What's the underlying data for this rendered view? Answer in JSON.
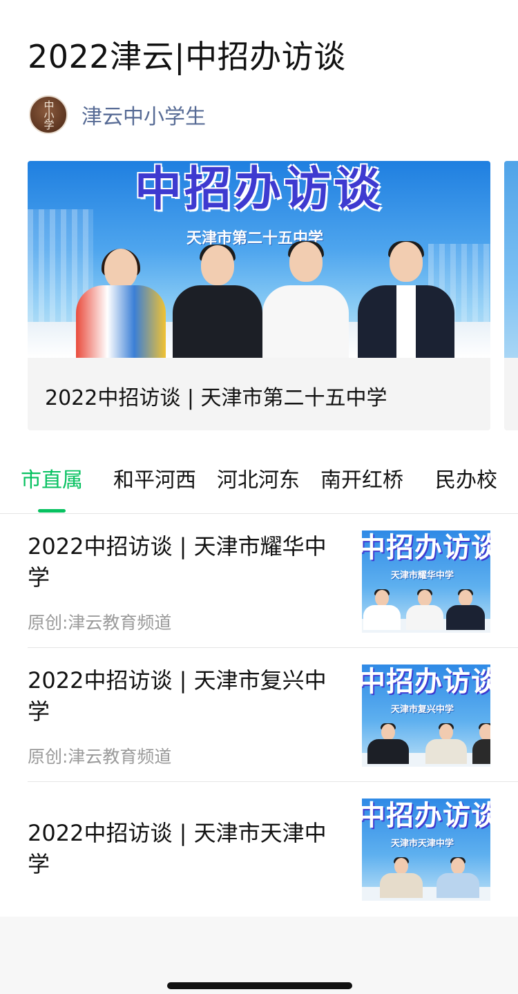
{
  "page_title": "2022津云|中招办访谈",
  "account": {
    "name": "津云中小学生",
    "avatar_text": "中小学"
  },
  "featured": {
    "banner_text": "中招办访谈",
    "banner_school": "天津市第二十五中学",
    "caption": "2022中招访谈 | 天津市第二十五中学"
  },
  "tabs": [
    {
      "label": "市直属",
      "active": true
    },
    {
      "label": "和平河西",
      "active": false
    },
    {
      "label": "河北河东",
      "active": false
    },
    {
      "label": "南开红桥",
      "active": false
    },
    {
      "label": "民办校",
      "active": false
    }
  ],
  "articles": [
    {
      "title": "2022中招访谈 | 天津市耀华中学",
      "source": "原创:津云教育频道",
      "thumb_banner": "中招办访谈",
      "thumb_school": "天津市耀华中学"
    },
    {
      "title": "2022中招访谈 | 天津市复兴中学",
      "source": "原创:津云教育频道",
      "thumb_banner": "中招办访谈",
      "thumb_school": "天津市复兴中学"
    },
    {
      "title": "2022中招访谈 | 天津市天津中学",
      "source": "",
      "thumb_banner": "中招办访谈",
      "thumb_school": "天津市天津中学"
    }
  ],
  "colors": {
    "accent": "#07c160",
    "account_link": "#576b95",
    "source_gray": "#9a9a9a",
    "banner_purple": "#3e3ad0"
  }
}
